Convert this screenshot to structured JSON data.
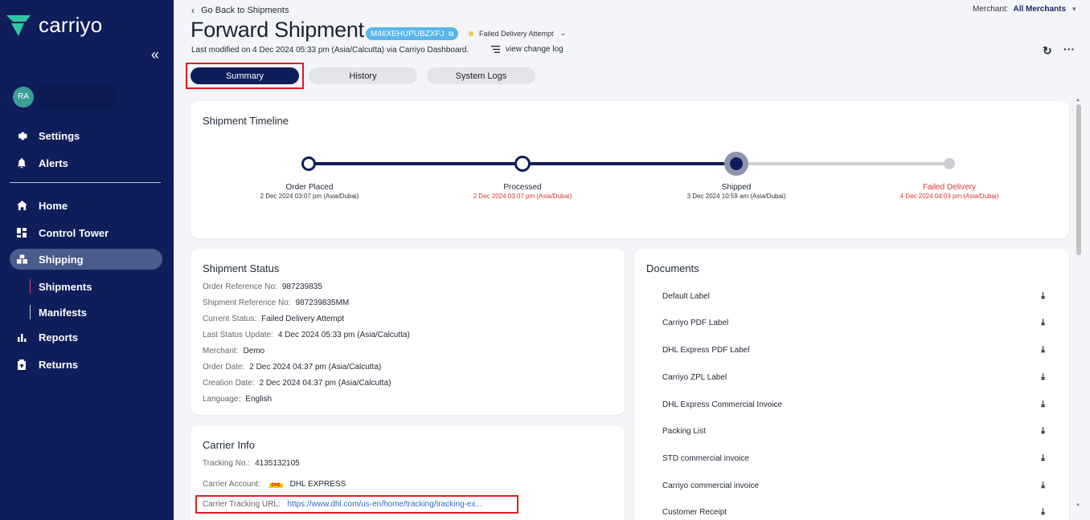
{
  "app": {
    "brand": "carriyo",
    "user_initials": "RA"
  },
  "sidebar": {
    "items_top": [
      {
        "label": "Settings",
        "icon": "gear-icon"
      },
      {
        "label": "Alerts",
        "icon": "bell-icon"
      }
    ],
    "items_main": [
      {
        "label": "Home",
        "icon": "home-icon"
      },
      {
        "label": "Control Tower",
        "icon": "dashboard-icon"
      },
      {
        "label": "Shipping",
        "icon": "boxes-icon",
        "active": true
      },
      {
        "label": "Reports",
        "icon": "bar-chart-icon"
      },
      {
        "label": "Returns",
        "icon": "return-box-icon"
      }
    ],
    "sub_items": [
      {
        "label": "Shipments",
        "active": true
      },
      {
        "label": "Manifests"
      }
    ]
  },
  "header": {
    "back_label": "Go Back to Shipments",
    "title": "Forward Shipment",
    "shipment_id": "M46XEHUPUBZXFJ",
    "status": "Failed Delivery Attempt",
    "status_color": "#f3c74f",
    "modified": "Last modified on 4 Dec 2024 05:33 pm (Asia/Calcutta) via Carriyo Dashboard.",
    "change_log": "view change log",
    "merchant_label": "Merchant:",
    "merchant_value": "All Merchants"
  },
  "tabs": [
    {
      "label": "Summary",
      "active": true
    },
    {
      "label": "History"
    },
    {
      "label": "System Logs"
    }
  ],
  "timeline": {
    "title": "Shipment Timeline",
    "steps": [
      {
        "name": "Order Placed",
        "date": "2 Dec 2024 03:07 pm (Asia/Dubai)",
        "state": "done"
      },
      {
        "name": "Processed",
        "date": "2 Dec 2024 03:07 pm (Asia/Dubai)",
        "state": "done",
        "date_red": true
      },
      {
        "name": "Shipped",
        "date": "3 Dec 2024 10:59 am (Asia/Dubai)",
        "state": "current"
      },
      {
        "name": "Failed Delivery",
        "date": "4 Dec 2024 04:03 pm (Asia/Dubai)",
        "state": "pending",
        "red": true
      }
    ]
  },
  "shipment_status": {
    "title": "Shipment Status",
    "rows": [
      {
        "label": "Order Reference No:",
        "value": "987239835"
      },
      {
        "label": "Shipment Reference No:",
        "value": "987239835MM"
      },
      {
        "label": "Current Status:",
        "value": "Failed Delivery Attempt"
      },
      {
        "label": "Last Status Update:",
        "value": "4 Dec 2024 05:33 pm (Asia/Calcutta)"
      },
      {
        "label": "Merchant:",
        "value": "Demo"
      },
      {
        "label": "Order Date:",
        "value": "2 Dec 2024 04:37 pm (Asia/Calcutta)"
      },
      {
        "label": "Creation Date:",
        "value": "2 Dec 2024 04:37 pm (Asia/Calcutta)"
      },
      {
        "label": "Language:",
        "value": "English"
      }
    ]
  },
  "carrier_info": {
    "title": "Carrier Info",
    "tracking_label": "Tracking No.:",
    "tracking_value": "4135132105",
    "account_label": "Carrier Account:",
    "account_logo": "DHL",
    "account_value": "DHL EXPRESS",
    "url_label": "Carrier Tracking URL:",
    "url_value": "https://www.dhl.com/us-en/home/tracking/tracking-ex..."
  },
  "documents": {
    "title": "Documents",
    "items": [
      "Default Label",
      "Carriyo PDF Label",
      "DHL Express PDF Label",
      "Carriyo ZPL Label",
      "DHL Express Commercial Invoice",
      "Packing List",
      "STD commercial invoice",
      "Carriyo commercial invoice",
      "Customer Receipt"
    ]
  },
  "colors": {
    "sidebar": "#0f1e5a",
    "accent": "#58b6ea",
    "danger": "#d93535",
    "highlight": "#e01b24"
  }
}
